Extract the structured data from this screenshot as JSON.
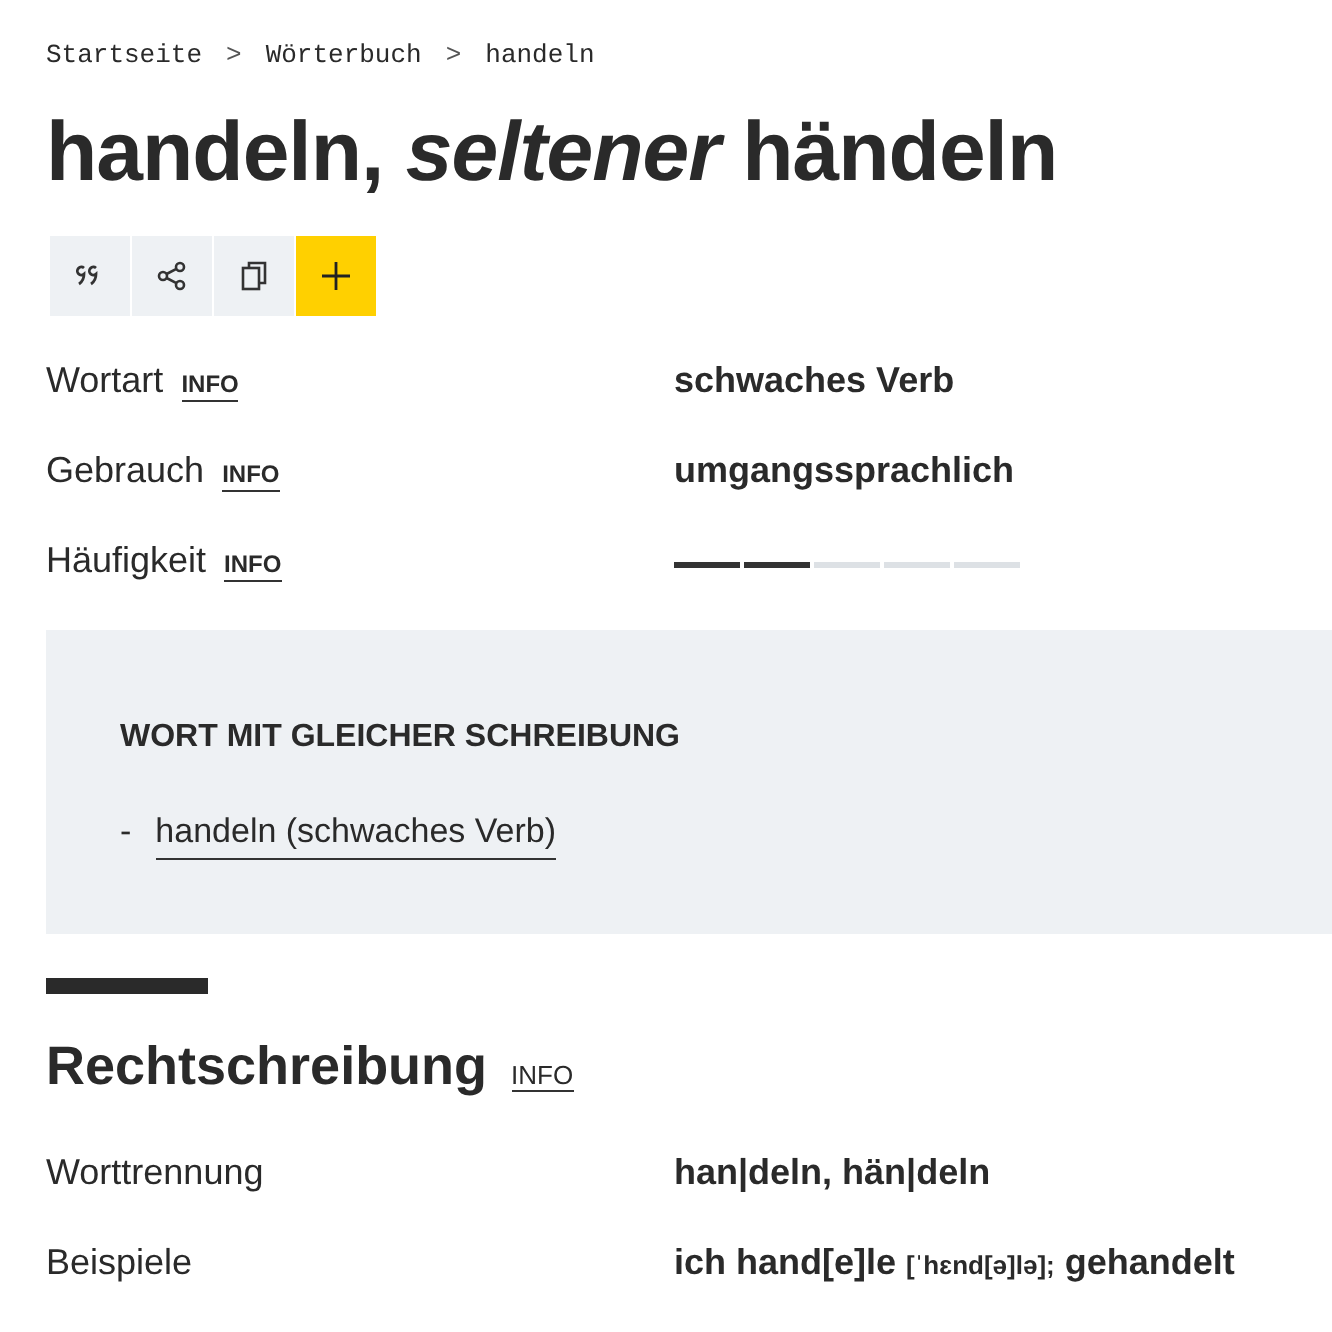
{
  "breadcrumb": [
    {
      "label": "Startseite"
    },
    {
      "label": "Wörterbuch"
    },
    {
      "label": "handeln"
    }
  ],
  "separator": ">",
  "title": "handeln, *seltener* händeln",
  "actions": [
    {
      "kind": "quote"
    },
    {
      "kind": "share"
    },
    {
      "kind": "copy"
    },
    {
      "kind": "add"
    }
  ],
  "properties": [
    {
      "label": "Wortart",
      "info": "INFO",
      "kind": "text",
      "value": "schwaches Verb"
    },
    {
      "label": "Gebrauch",
      "info": "INFO",
      "kind": "text",
      "value": "umgangssprachlich"
    },
    {
      "label": "Häufigkeit",
      "info": "INFO",
      "kind": "meter",
      "level": 0.4
    }
  ],
  "same_spelling": {
    "heading": "WORT MIT GLEICHER SCHREIBUNG",
    "items": [
      {
        "bullet": "-",
        "link": "handeln (schwaches Verb)"
      }
    ]
  },
  "section": {
    "title": "Rechtschreibung",
    "info": "INFO",
    "rows": [
      {
        "label": "Worttrennung",
        "parts": [
          {
            "kind": "text",
            "text": "han|deln, hän|deln"
          }
        ]
      },
      {
        "label": "Beispiele",
        "parts": [
          {
            "kind": "text",
            "text": "ich hand[e]le"
          },
          {
            "kind": "phonetic",
            "text": "[ˈhɛnd[ə]lə];"
          },
          {
            "kind": "text",
            "text": "gehandelt"
          }
        ]
      }
    ]
  }
}
